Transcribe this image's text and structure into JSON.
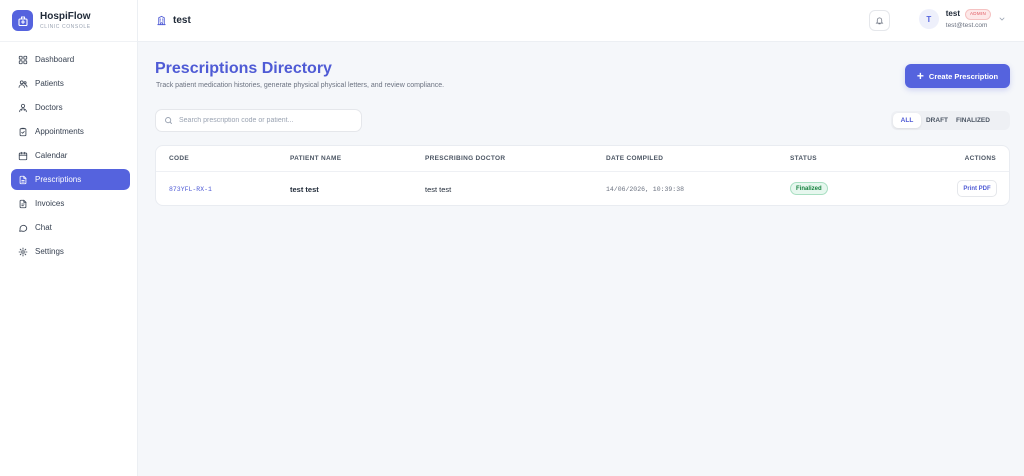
{
  "brand": {
    "name": "HospiFlow",
    "subtitle": "CLINIC CONSOLE"
  },
  "sidebar": {
    "items": [
      {
        "label": "Dashboard",
        "icon": "grid-icon"
      },
      {
        "label": "Patients",
        "icon": "users-icon"
      },
      {
        "label": "Doctors",
        "icon": "stethoscope-icon"
      },
      {
        "label": "Appointments",
        "icon": "clipboard-icon"
      },
      {
        "label": "Calendar",
        "icon": "calendar-icon"
      },
      {
        "label": "Prescriptions",
        "icon": "file-icon",
        "active": true
      },
      {
        "label": "Invoices",
        "icon": "receipt-icon"
      },
      {
        "label": "Chat",
        "icon": "chat-icon"
      },
      {
        "label": "Settings",
        "icon": "gear-icon"
      }
    ]
  },
  "header": {
    "title": "test",
    "user": {
      "initial": "T",
      "name": "test",
      "role": "ADMIN",
      "email": "test@test.com"
    }
  },
  "main": {
    "title": "Prescriptions Directory",
    "subtitle": "Track patient medication histories, generate physical physical letters, and review compliance.",
    "create_label": "Create Prescription",
    "search_placeholder": "Search prescription code or patient...",
    "filters": [
      "ALL",
      "DRAFT",
      "FINALIZED"
    ],
    "active_filter": "ALL"
  },
  "table": {
    "columns": [
      "CODE",
      "PATIENT NAME",
      "PRESCRIBING DOCTOR",
      "DATE COMPILED",
      "STATUS",
      "ACTIONS"
    ],
    "rows": [
      {
        "code": "873YFL-RX-1",
        "patient": "test test",
        "doctor": "test test",
        "date": "14/06/2026, 10:39:38",
        "status": "Finalized",
        "action": "Print PDF"
      }
    ]
  },
  "colors": {
    "accent": "#5563de",
    "title": "#4f5bd5",
    "status_ok_bg": "#e6f7ee",
    "status_ok_text": "#15803d",
    "admin_badge": "#e0555d"
  }
}
